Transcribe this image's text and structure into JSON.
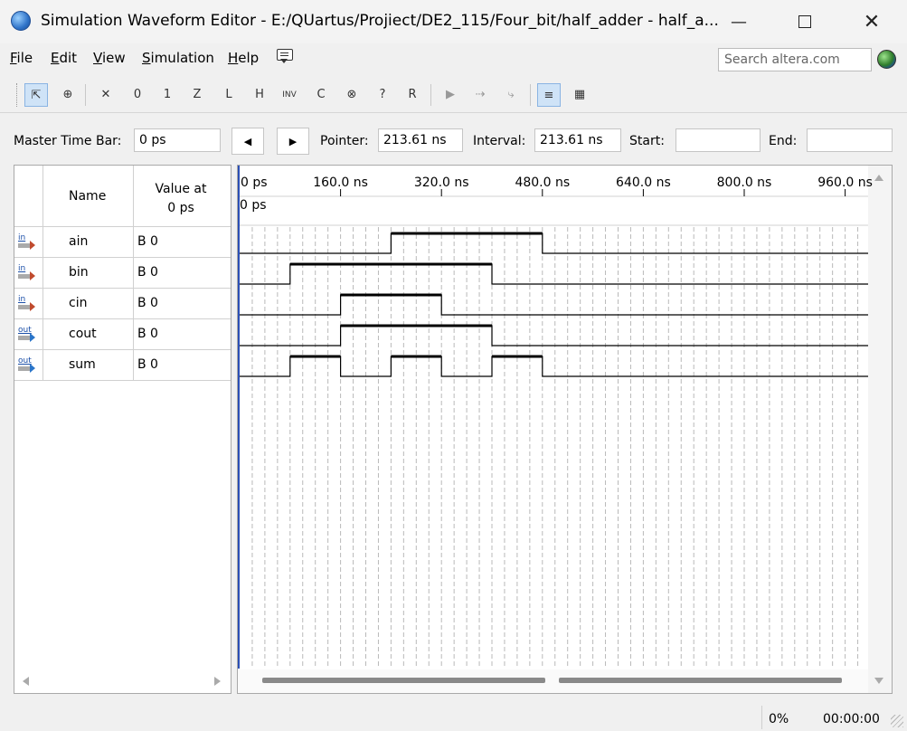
{
  "window": {
    "title": "Simulation Waveform Editor - E:/QUartus/Projiect/DE2_115/Four_bit/half_adder - half_a...",
    "minimize_glyph": "—",
    "close_glyph": "✕"
  },
  "menu": {
    "items": [
      {
        "key": "F",
        "rest": "ile"
      },
      {
        "key": "E",
        "rest": "dit"
      },
      {
        "key": "V",
        "rest": "iew"
      },
      {
        "key": "S",
        "rest": "imulation"
      },
      {
        "key": "H",
        "rest": "elp"
      }
    ],
    "search_placeholder": "Search altera.com"
  },
  "toolbar": {
    "icons": [
      "selection-tool-icon",
      "zoom-tool-icon",
      "unknown-value-icon",
      "forcing-low-icon",
      "forcing-high-icon",
      "high-impedance-icon",
      "weak-low-icon",
      "weak-high-icon",
      "invert-icon",
      "count-value-icon",
      "overwrite-clock-icon",
      "random-values-icon",
      "arbitrary-value-icon",
      "snap-to-grid-icon",
      "run-functional-simulation-icon",
      "run-timing-simulation-icon",
      "generate-netlist-icon",
      "waveform-compare-icon",
      "grid-settings-icon"
    ],
    "glyphs": [
      "⇱",
      "⊕",
      "✕",
      "0",
      "1",
      "Z",
      "L",
      "H",
      "INV",
      "C",
      "⊗",
      "?",
      "R",
      "▶",
      "⇢",
      "⤷",
      "≡",
      "▦"
    ]
  },
  "timebar": {
    "master_label": "Master Time Bar:",
    "master_value": "0 ps",
    "prev_glyph": "◀",
    "next_glyph": "▶",
    "pointer_label": "Pointer:",
    "pointer_value": "213.61 ns",
    "interval_label": "Interval:",
    "interval_value": "213.61 ns",
    "start_label": "Start:",
    "start_value": "",
    "end_label": "End:",
    "end_value": ""
  },
  "signals": {
    "header_name": "Name",
    "header_value_line1": "Value at",
    "header_value_line2": "0 ps",
    "rows": [
      {
        "dir": "in",
        "name": "ain",
        "value": "B 0"
      },
      {
        "dir": "in",
        "name": "bin",
        "value": "B 0"
      },
      {
        "dir": "in",
        "name": "cin",
        "value": "B 0"
      },
      {
        "dir": "out",
        "name": "cout",
        "value": "B 0"
      },
      {
        "dir": "out",
        "name": "sum",
        "value": "B 0"
      }
    ]
  },
  "waveform": {
    "ticks": [
      "0 ps",
      "160.0 ns",
      "320.0 ns",
      "480.0 ns",
      "640.0 ns",
      "800.0 ns",
      "960.0 ns"
    ],
    "tick_values_ns": [
      0,
      160,
      320,
      480,
      640,
      800,
      960
    ],
    "cursor_label": "0 ps",
    "view_end_ns": 1000,
    "grid_step_ns": 20,
    "waves": [
      {
        "name": "ain",
        "transitions_ns": [
          0,
          240,
          480
        ],
        "levels": [
          0,
          1,
          0
        ]
      },
      {
        "name": "bin",
        "transitions_ns": [
          0,
          80,
          400
        ],
        "levels": [
          0,
          1,
          0
        ]
      },
      {
        "name": "cin",
        "transitions_ns": [
          0,
          160,
          320
        ],
        "levels": [
          0,
          1,
          0
        ]
      },
      {
        "name": "cout",
        "transitions_ns": [
          0,
          160,
          400
        ],
        "levels": [
          0,
          1,
          0
        ]
      },
      {
        "name": "sum",
        "transitions_ns": [
          0,
          80,
          160,
          240,
          320,
          400,
          480
        ],
        "levels": [
          0,
          1,
          0,
          1,
          0,
          1,
          0
        ]
      }
    ]
  },
  "status": {
    "progress": "0%",
    "elapsed": "00:00:00"
  }
}
